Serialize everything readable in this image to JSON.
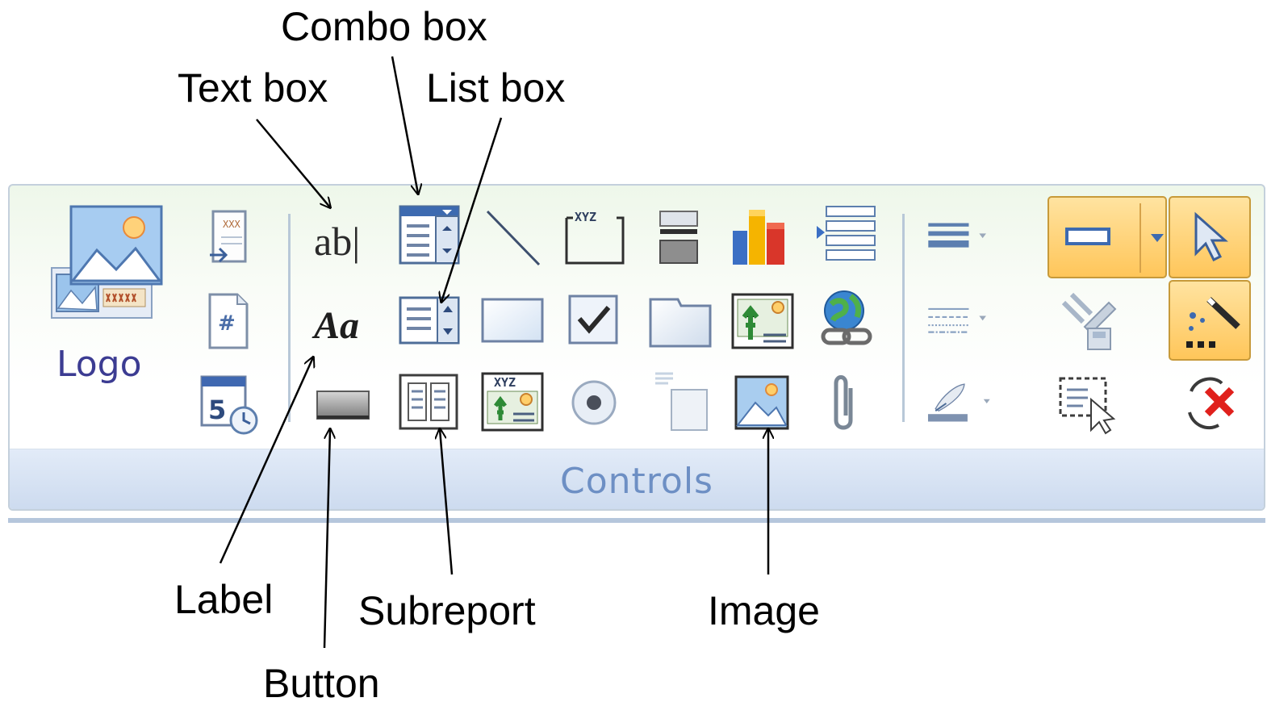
{
  "callouts": {
    "combo_box": "Combo box",
    "text_box": "Text box",
    "list_box": "List box",
    "label": "Label",
    "subreport": "Subreport",
    "image": "Image",
    "button": "Button"
  },
  "ribbon": {
    "group_label": "Controls",
    "logo_label": "Logo",
    "text_box_glyph": "ab|",
    "label_glyph": "Aa",
    "page_number_glyph": "#",
    "date_glyph": "5",
    "xyz_glyph": "XYZ"
  },
  "icons": {
    "logo": "logo-icon",
    "title": "title-icon",
    "page_numbers": "page-numbers-icon",
    "date_time": "date-time-icon",
    "text_box": "text-box-icon",
    "label": "label-icon",
    "button": "button-icon",
    "combo_box": "combo-box-icon",
    "list_box": "list-box-icon",
    "subreport": "subreport-icon",
    "line": "line-icon",
    "rectangle": "rectangle-icon",
    "bound_object_frame": "bound-object-frame-icon",
    "option_group": "option-group-icon",
    "check_box": "check-box-icon",
    "option_button": "option-button-icon",
    "page_break": "page-break-icon",
    "tab_control": "tab-control-icon",
    "toggle_button": "toggle-button-icon",
    "chart": "chart-icon",
    "unbound_object_frame": "unbound-object-frame-icon",
    "image": "image-icon",
    "insert_page_break": "insert-page-break-icon",
    "hyperlink": "hyperlink-icon",
    "attachment": "attachment-icon",
    "line_thickness": "line-thickness-icon",
    "line_type": "line-type-icon",
    "line_color": "line-color-icon",
    "set_control_defaults": "set-control-defaults-icon",
    "select_all": "select-all-icon",
    "rectangle_tool": "rectangle-tool-icon",
    "select": "select-pointer-icon",
    "control_wizards": "control-wizards-icon",
    "activex": "activex-icon"
  },
  "colors": {
    "group_label": "#6d8fc4",
    "highlight": "#ffc65a",
    "icon_blue": "#4a6da8",
    "ribbon_border": "#c4d0dc"
  }
}
